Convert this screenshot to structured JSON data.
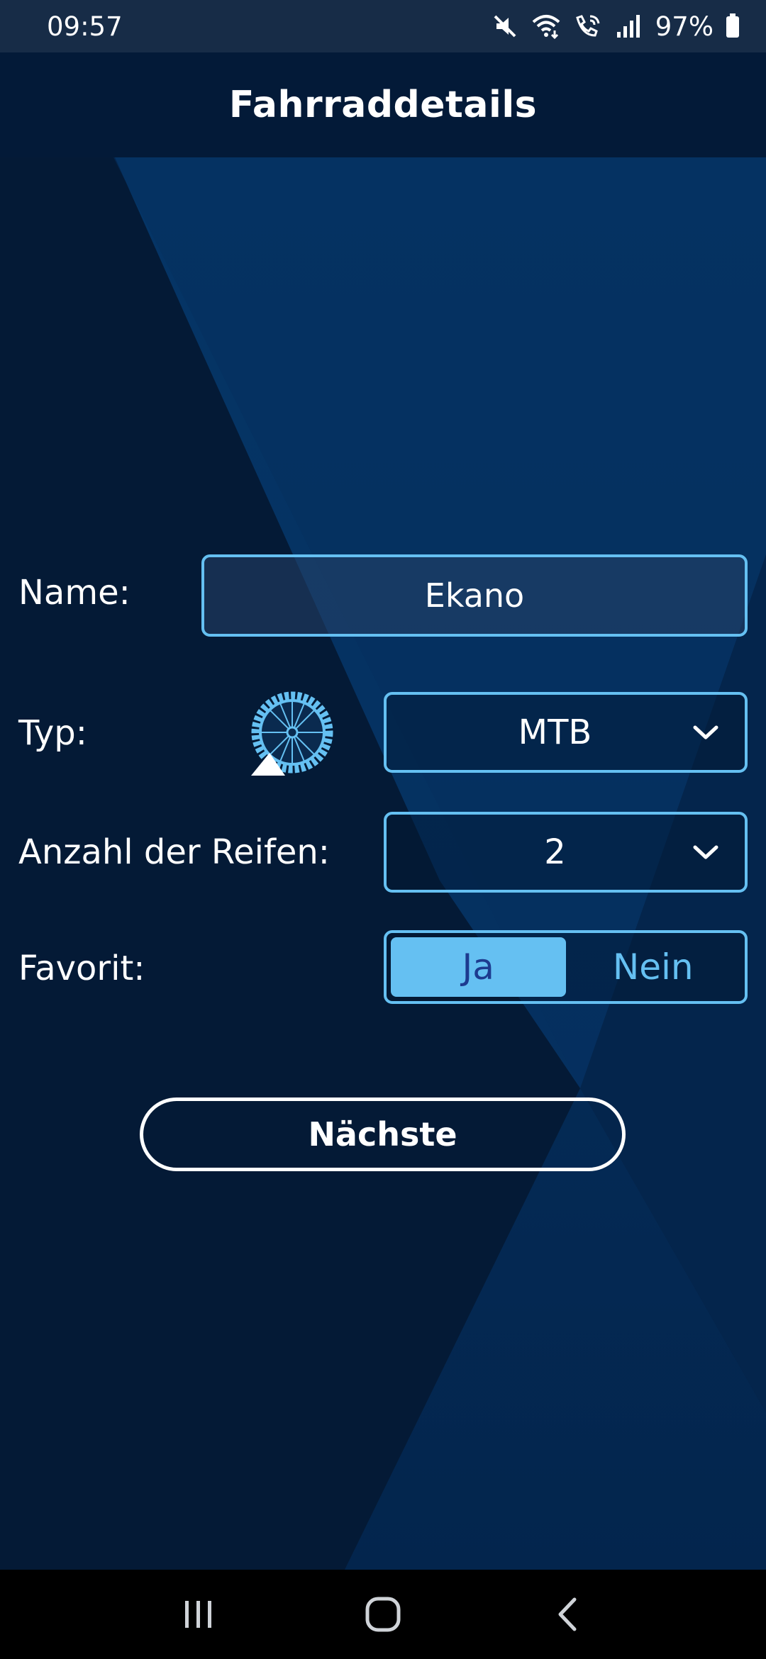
{
  "status_bar": {
    "time": "09:57",
    "battery": "97%",
    "icons": [
      "mute-icon",
      "wifi-icon",
      "wifi-calling-icon",
      "signal-icon",
      "battery-icon"
    ]
  },
  "header": {
    "title": "Fahrraddetails"
  },
  "form": {
    "name": {
      "label": "Name:",
      "value": "Ekano"
    },
    "type": {
      "label": "Typ:",
      "icon": "mtb-wheel-icon",
      "selected": "MTB"
    },
    "tires": {
      "label": "Anzahl der Reifen:",
      "selected": "2"
    },
    "favorite": {
      "label": "Favorit:",
      "options": [
        "Ja",
        "Nein"
      ],
      "selected": "Ja"
    }
  },
  "actions": {
    "next_label": "Nächste"
  },
  "nav": {
    "icons": [
      "recents-icon",
      "home-icon",
      "back-icon"
    ]
  },
  "colors": {
    "background": "#041a36",
    "header": "#031a38",
    "accent": "#65c0f2",
    "toggle_active_text": "#1d3b8f"
  }
}
